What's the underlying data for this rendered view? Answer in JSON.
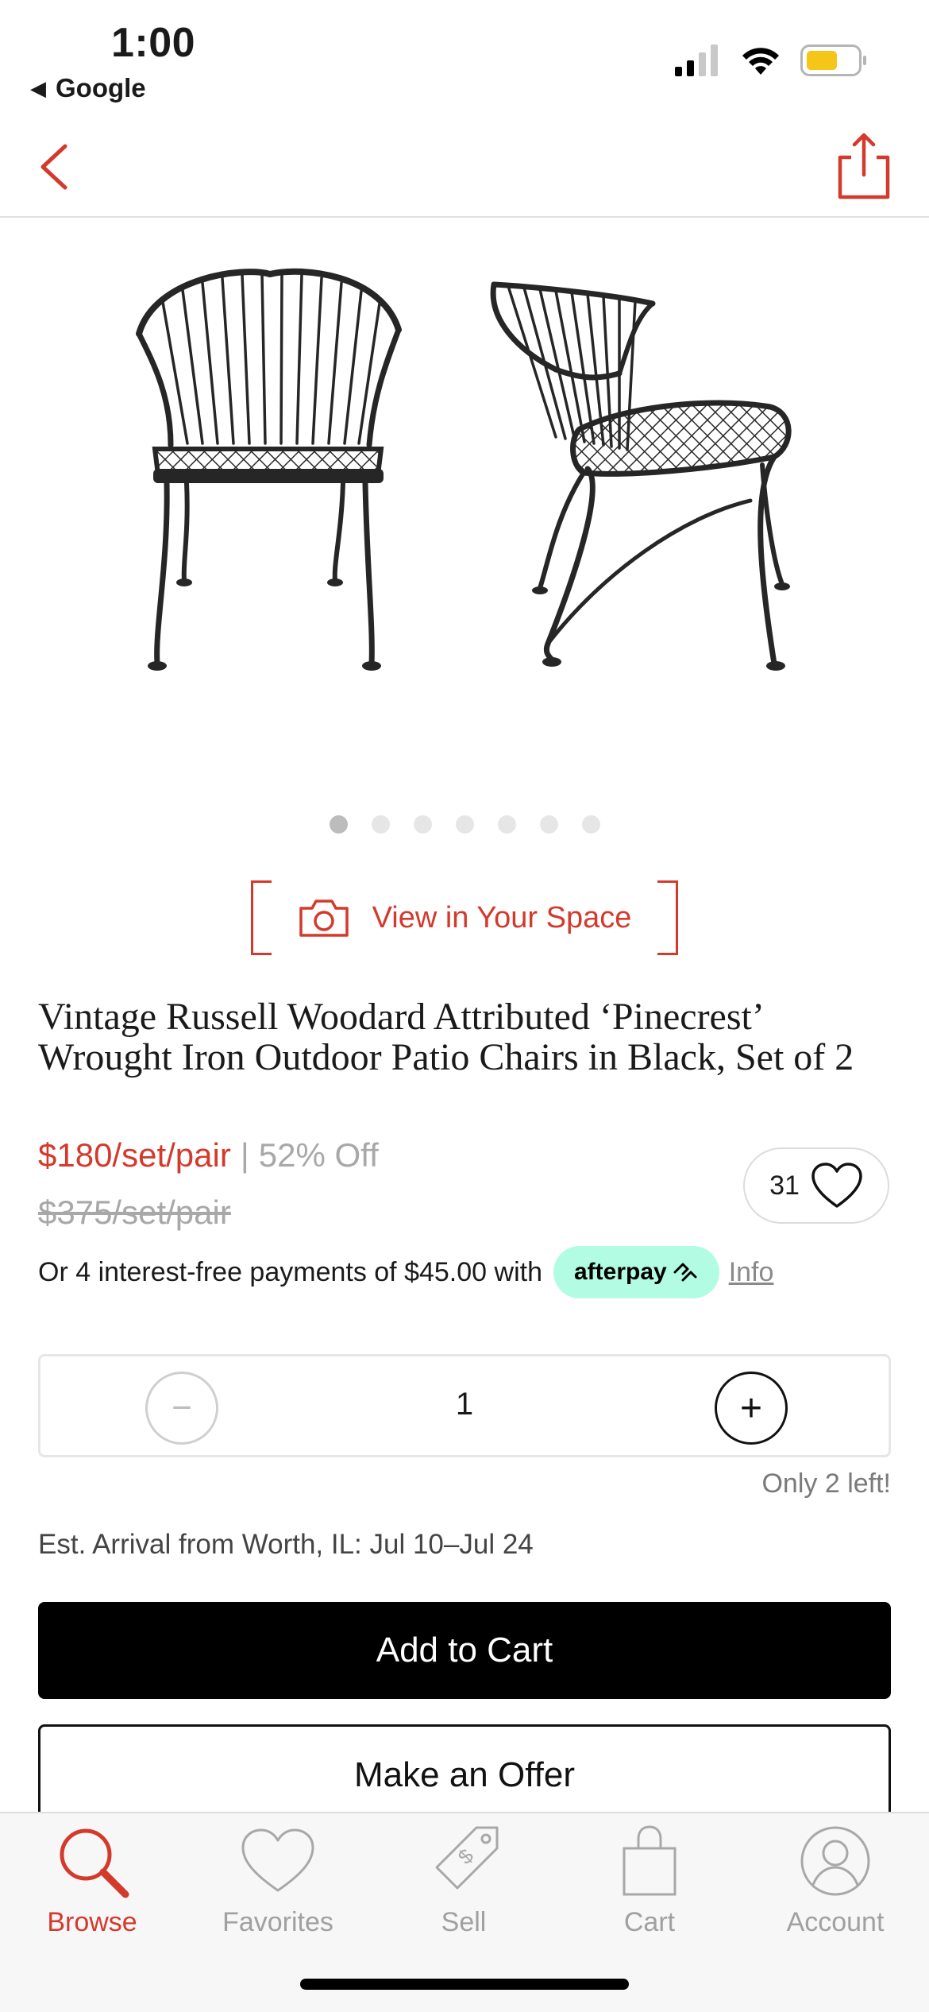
{
  "status_bar": {
    "time": "1:00",
    "back_app": "Google"
  },
  "nav": {
    "back_icon": "chevron-left-icon",
    "share_icon": "share-icon"
  },
  "gallery": {
    "image_alt": "Two black wrought iron patio chairs, front and side view",
    "total_dots": 7,
    "active_index": 0
  },
  "view_in_space": {
    "label": "View in Your Space",
    "icon": "camera-icon"
  },
  "product": {
    "title": "Vintage Russell Woodard Attributed ‘Pinecrest’ Wrought Iron Outdoor Patio Chairs in Black, Set of 2",
    "price": "$180/set/pair",
    "separator": "|",
    "discount": "52% Off",
    "original_price": "$375/set/pair",
    "favorites_count": "31"
  },
  "afterpay": {
    "text": "Or 4 interest-free payments of $45.00 with",
    "badge": "afterpay",
    "info": "Info"
  },
  "quantity": {
    "minus": "−",
    "value": "1",
    "plus": "+"
  },
  "stock_note": "Only 2 left!",
  "arrival": "Est. Arrival from Worth, IL: Jul 10–Jul 24",
  "actions": {
    "add_to_cart": "Add to Cart",
    "make_offer": "Make an Offer"
  },
  "tabs": [
    {
      "label": "Browse",
      "icon": "search-icon",
      "active": true
    },
    {
      "label": "Favorites",
      "icon": "heart-icon",
      "active": false
    },
    {
      "label": "Sell",
      "icon": "price-tag-icon",
      "active": false
    },
    {
      "label": "Cart",
      "icon": "shopping-bag-icon",
      "active": false
    },
    {
      "label": "Account",
      "icon": "user-icon",
      "active": false
    }
  ],
  "colors": {
    "accent": "#d33a2c",
    "afterpay_mint": "#b2fce4",
    "muted": "#a8a8a8"
  }
}
